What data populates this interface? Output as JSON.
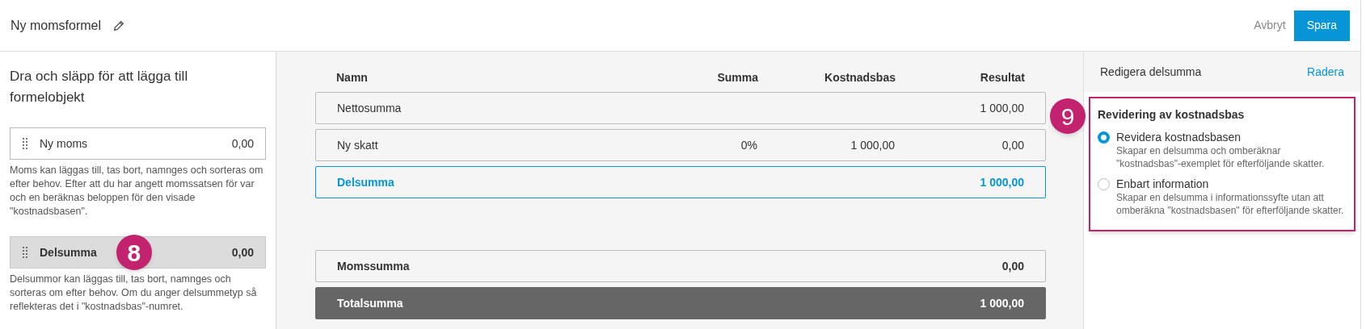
{
  "header": {
    "title": "Ny momsformel",
    "cancel": "Avbryt",
    "save": "Spara"
  },
  "palette": {
    "title": "Dra och släpp för att lägga till formelobjekt",
    "items": [
      {
        "label": "Ny moms",
        "value": "0,00",
        "selected": false,
        "description": "Moms kan läggas till, tas bort, namnges och sorteras om efter behov. Efter att du har angett momssatsen för var och en beräknas beloppen för den visade \"kostnadsbasen\"."
      },
      {
        "label": "Delsumma",
        "value": "0,00",
        "selected": true,
        "description": "Delsummor kan läggas till, tas bort, namnges och sorteras om efter behov. Om du anger delsummetyp så reflekteras det i \"kostnadsbas\"-numret.",
        "callout": "8"
      }
    ]
  },
  "table": {
    "columns": [
      "Namn",
      "Summa",
      "Kostnadsbas",
      "Resultat"
    ],
    "rows": [
      {
        "kind": "plain",
        "name": "Nettosumma",
        "summa": "",
        "kostnadsbas": "",
        "resultat": "1 000,00",
        "selected": false
      },
      {
        "kind": "plain",
        "name": "Ny skatt",
        "summa": "0%",
        "kostnadsbas": "1 000,00",
        "resultat": "0,00",
        "selected": false
      },
      {
        "kind": "plain",
        "name": "Delsumma",
        "summa": "",
        "kostnadsbas": "",
        "resultat": "1 000,00",
        "selected": true
      },
      {
        "kind": "gap"
      },
      {
        "kind": "bold",
        "name": "Momssumma",
        "summa": "",
        "kostnadsbas": "",
        "resultat": "0,00",
        "selected": false
      },
      {
        "kind": "total",
        "name": "Totalsumma",
        "summa": "",
        "kostnadsbas": "",
        "resultat": "1 000,00",
        "selected": false
      }
    ]
  },
  "editor": {
    "title": "Redigera delsumma",
    "delete": "Radera",
    "callout": "9",
    "group_title": "Revidering av kostnadsbas",
    "options": [
      {
        "label": "Revidera kostnadsbasen",
        "description": "Skapar en delsumma och omberäknar \"kostnadsbas\"-exemplet för efterföljande skatter.",
        "selected": true
      },
      {
        "label": "Enbart information",
        "description": "Skapar en delsumma i informationssyfte utan att omberäkna \"kostnadsbasen\" för efterföljande skatter.",
        "selected": false
      }
    ]
  }
}
